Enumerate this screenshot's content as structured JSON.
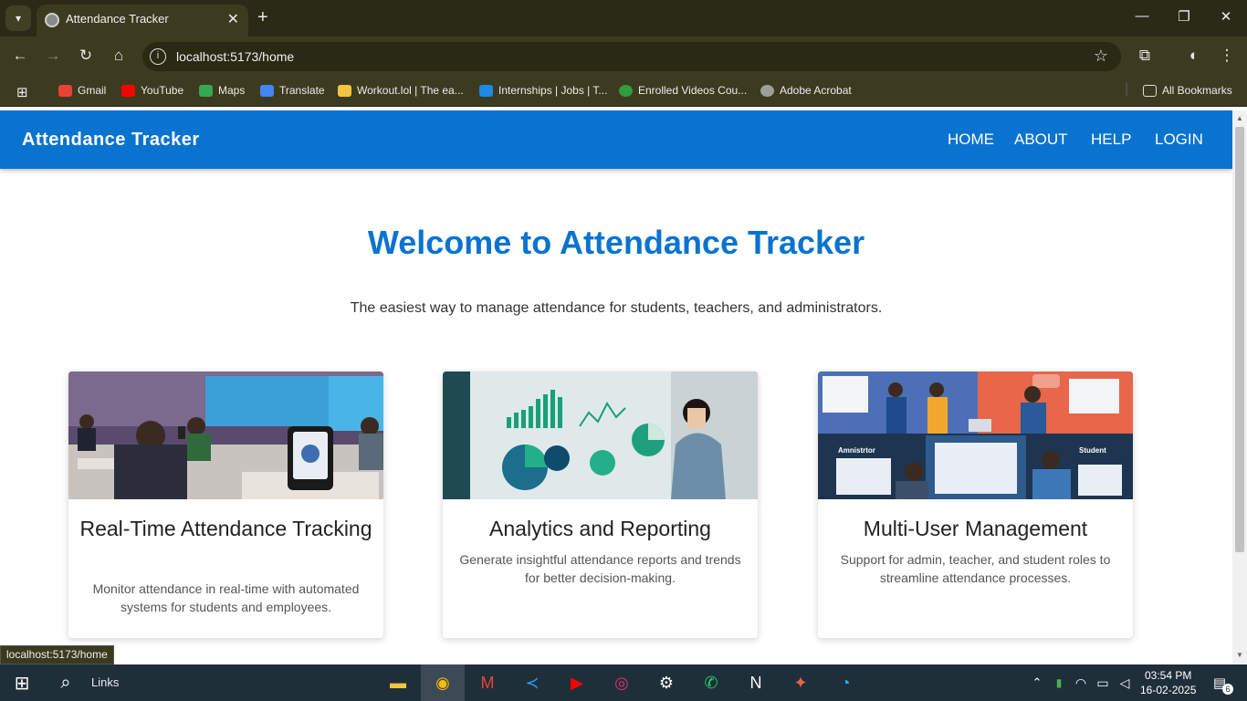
{
  "browser": {
    "tab_title": "Attendance Tracker",
    "url": "localhost:5173/home",
    "status_url": "localhost:5173/home",
    "bookmarks": [
      {
        "label": "Gmail",
        "color": "#ea4335"
      },
      {
        "label": "YouTube",
        "color": "#ff0000"
      },
      {
        "label": "Maps",
        "color": "#34a853"
      },
      {
        "label": "Translate",
        "color": "#4285f4"
      },
      {
        "label": "Workout.lol | The ea...",
        "color": "#f4c542"
      },
      {
        "label": "Internships | Jobs | T...",
        "color": "#1e88e5"
      },
      {
        "label": "Enrolled Videos Cou...",
        "color": "#2e9e3e"
      },
      {
        "label": "Adobe Acrobat",
        "color": "#9e9e9e"
      }
    ],
    "all_bookmarks": "All Bookmarks"
  },
  "app": {
    "brand": "Attendance Tracker",
    "nav": [
      "HOME",
      "ABOUT",
      "HELP",
      "LOGIN"
    ],
    "hero_title": "Welcome to Attendance Tracker",
    "hero_subtitle": "The easiest way to manage attendance for students, teachers, and administrators.",
    "cards": [
      {
        "title": "Real-Time Attendance Tracking",
        "desc": "Monitor attendance in real-time with automated systems for students and employees."
      },
      {
        "title": "Analytics and Reporting",
        "desc": "Generate insightful attendance reports and trends for better decision-making."
      },
      {
        "title": "Multi-User Management",
        "desc": "Support for admin, teacher, and student roles to streamline attendance processes."
      }
    ],
    "card3_labels": {
      "left": "Amnistrtor",
      "right": "Student"
    },
    "accent": "#0a73d0"
  },
  "taskbar": {
    "search_label": "Links",
    "time": "03:54 PM",
    "date": "16-02-2025",
    "notifications": "6"
  }
}
